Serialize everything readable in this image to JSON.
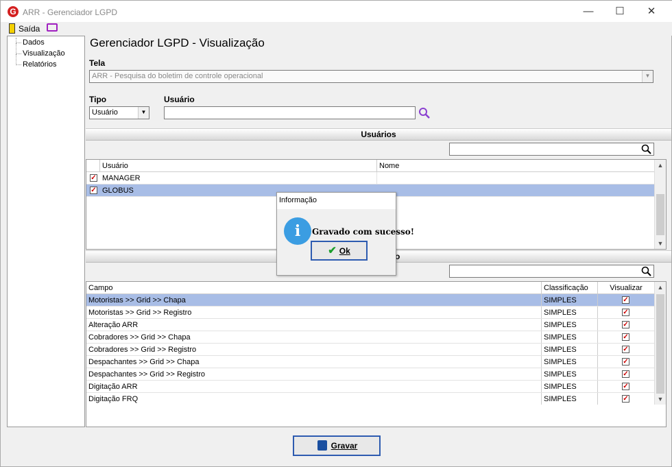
{
  "window": {
    "title": "ARR - Gerenciador LGPD",
    "logo": "G",
    "minimize": "—",
    "maximize": "☐",
    "close": "✕"
  },
  "menu": {
    "exit_label": "Saída"
  },
  "sidebar": {
    "items": [
      {
        "label": "Dados"
      },
      {
        "label": "Visualização"
      },
      {
        "label": "Relatórios"
      }
    ]
  },
  "page": {
    "title": "Gerenciador LGPD - Visualização"
  },
  "tela": {
    "label": "Tela",
    "value": "ARR - Pesquisa do boletim de controle operacional"
  },
  "tipo": {
    "label": "Tipo",
    "value": "Usuário"
  },
  "usuario": {
    "label": "Usuário",
    "value": ""
  },
  "users_section": {
    "title": "Usuários",
    "search_value": "",
    "headers": [
      "Usuário",
      "Nome"
    ],
    "rows": [
      {
        "checked": true,
        "usuario": "MANAGER",
        "nome": ""
      },
      {
        "checked": true,
        "usuario": "GLOBUS",
        "nome": ""
      }
    ]
  },
  "fields_section": {
    "title": "o",
    "search_value": "",
    "headers": [
      "Campo",
      "Classificação",
      "Visualizar"
    ],
    "rows": [
      {
        "campo": " Motoristas >> Grid >> Chapa",
        "classificacao": "SIMPLES",
        "visualizar": true
      },
      {
        "campo": " Motoristas >> Grid >> Registro",
        "classificacao": "SIMPLES",
        "visualizar": true
      },
      {
        "campo": "Alteração ARR",
        "classificacao": "SIMPLES",
        "visualizar": true
      },
      {
        "campo": "Cobradores >> Grid >> Chapa",
        "classificacao": "SIMPLES",
        "visualizar": true
      },
      {
        "campo": "Cobradores >> Grid >> Registro",
        "classificacao": "SIMPLES",
        "visualizar": true
      },
      {
        "campo": "Despachantes >> Grid >> Chapa",
        "classificacao": "SIMPLES",
        "visualizar": true
      },
      {
        "campo": "Despachantes >> Grid >> Registro",
        "classificacao": "SIMPLES",
        "visualizar": true
      },
      {
        "campo": "Digitação ARR",
        "classificacao": "SIMPLES",
        "visualizar": true
      },
      {
        "campo": "Digitação FRQ",
        "classificacao": "SIMPLES",
        "visualizar": true
      }
    ]
  },
  "dialog": {
    "title": "Informação",
    "icon": "i",
    "message": "Gravado com sucesso!",
    "ok_label": "Ok"
  },
  "footer": {
    "save_label": "Gravar"
  }
}
